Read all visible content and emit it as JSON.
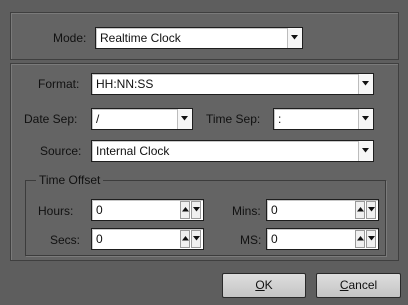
{
  "mode": {
    "label": "Mode:",
    "value": "Realtime Clock"
  },
  "format": {
    "label": "Format:",
    "value": "HH:NN:SS"
  },
  "date_sep": {
    "label": "Date Sep:",
    "value": "/"
  },
  "time_sep": {
    "label": "Time Sep:",
    "value": ":"
  },
  "source": {
    "label": "Source:",
    "value": "Internal Clock"
  },
  "time_offset": {
    "title": "Time Offset",
    "hours": {
      "label": "Hours:",
      "value": "0"
    },
    "mins": {
      "label": "Mins:",
      "value": "0"
    },
    "secs": {
      "label": "Secs:",
      "value": "0"
    },
    "ms": {
      "label": "MS:",
      "value": "0"
    }
  },
  "buttons": {
    "ok": {
      "label": "OK",
      "mnemonic": "O",
      "rest": "K"
    },
    "cancel": {
      "label": "Cancel",
      "mnemonic": "C",
      "rest": "ancel"
    }
  },
  "colors": {
    "background": "#5e5e5e",
    "field": "#ffffff",
    "button": "#d2d2d2"
  }
}
